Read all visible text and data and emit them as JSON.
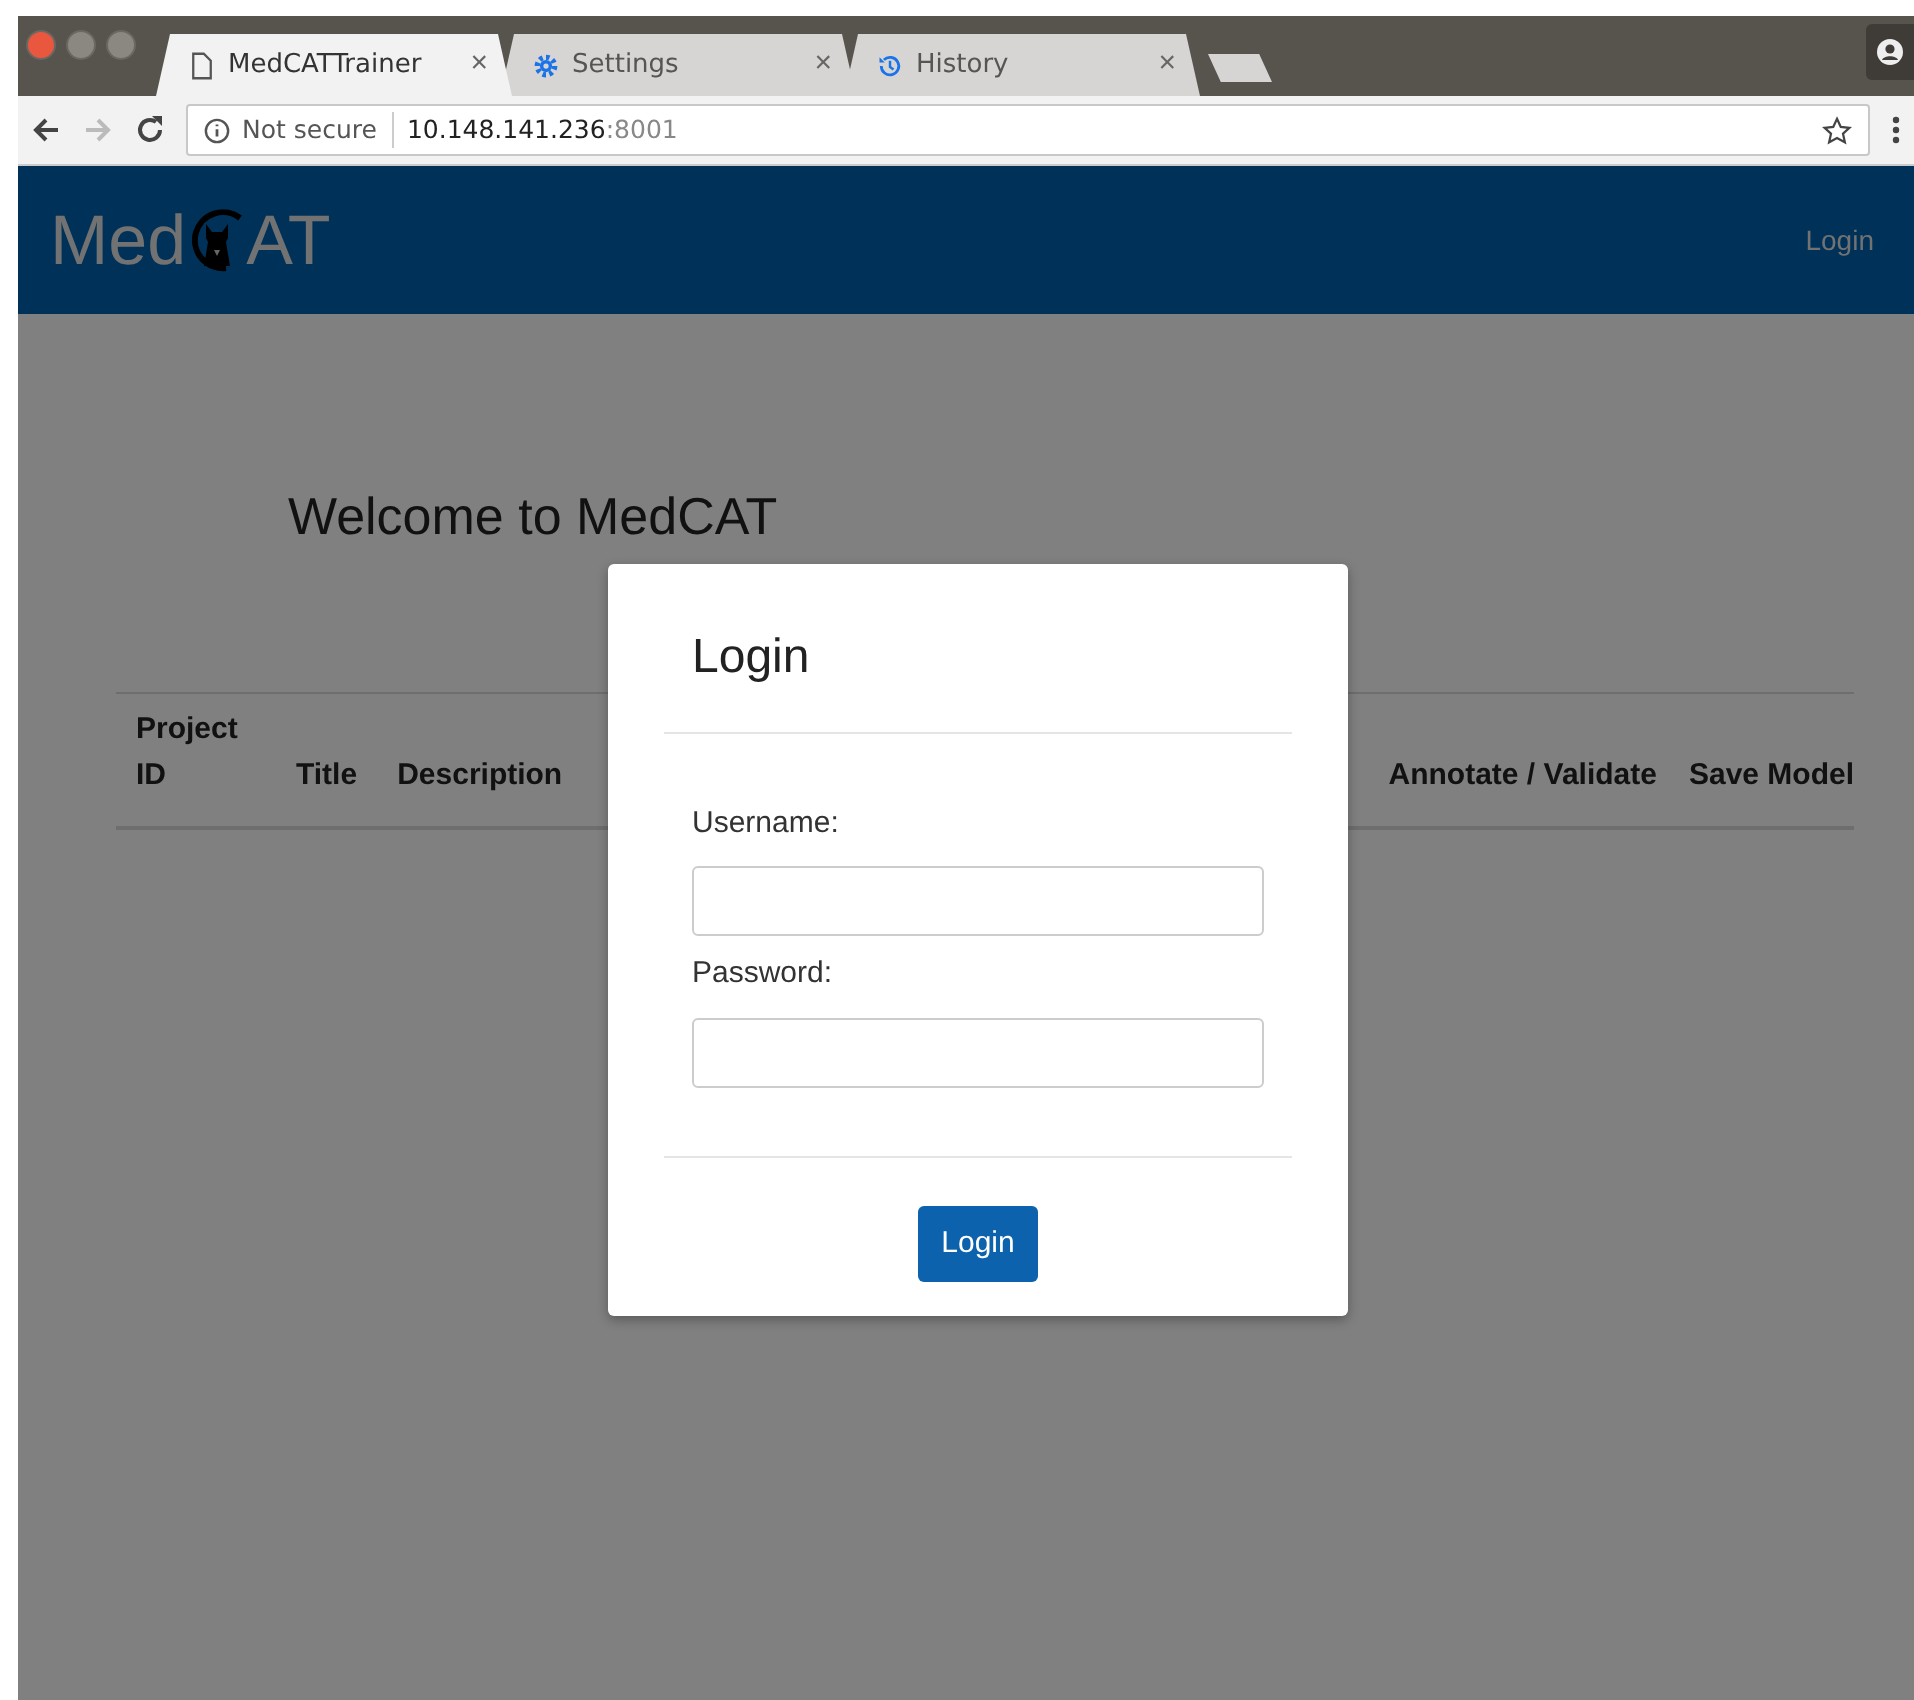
{
  "browser": {
    "tabs": [
      {
        "title": "MedCATTrainer",
        "kind": "page",
        "selected": true
      },
      {
        "title": "Settings",
        "kind": "gear",
        "selected": false
      },
      {
        "title": "History",
        "kind": "history",
        "selected": false
      }
    ],
    "close_glyph": "×",
    "address": {
      "security": "Not secure",
      "host": "10.148.141.236",
      "port": ":8001"
    }
  },
  "navbar": {
    "brand_start": "Med",
    "brand_end": "AT",
    "link": "Login"
  },
  "page": {
    "heading": "Welcome to MedCAT",
    "columns_left": [
      "Project ID",
      "Title",
      "Description"
    ],
    "columns_right": [
      "Annotate / Validate",
      "Save Model"
    ]
  },
  "modal": {
    "title": "Login",
    "fields": [
      {
        "label": "Username:"
      },
      {
        "label": "Password:"
      }
    ],
    "button": "Login"
  }
}
